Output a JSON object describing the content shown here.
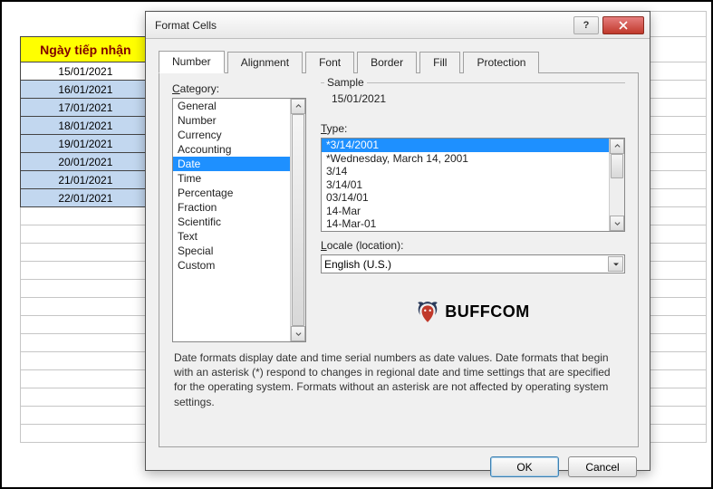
{
  "spreadsheet": {
    "header": "Ngày tiếp nhận",
    "rows": [
      "15/01/2021",
      "16/01/2021",
      "17/01/2021",
      "18/01/2021",
      "19/01/2021",
      "20/01/2021",
      "21/01/2021",
      "22/01/2021"
    ]
  },
  "dialog": {
    "title": "Format Cells",
    "tabs": [
      "Number",
      "Alignment",
      "Font",
      "Border",
      "Fill",
      "Protection"
    ],
    "category_label": "Category:",
    "categories": [
      "General",
      "Number",
      "Currency",
      "Accounting",
      "Date",
      "Time",
      "Percentage",
      "Fraction",
      "Scientific",
      "Text",
      "Special",
      "Custom"
    ],
    "selected_category": "Date",
    "sample_label": "Sample",
    "sample_value": "15/01/2021",
    "type_label": "Type:",
    "types": [
      "*3/14/2001",
      "*Wednesday, March 14, 2001",
      "3/14",
      "3/14/01",
      "03/14/01",
      "14-Mar",
      "14-Mar-01"
    ],
    "selected_type": "*3/14/2001",
    "locale_label": "Locale (location):",
    "locale_value": "English (U.S.)",
    "logo_text": "BUFFCOM",
    "footer_text": "Date formats display date and time serial numbers as date values.  Date formats that begin with an asterisk (*) respond to changes in regional date and time settings that are specified for the operating system. Formats without an asterisk are not affected by operating system settings.",
    "ok_label": "OK",
    "cancel_label": "Cancel"
  }
}
